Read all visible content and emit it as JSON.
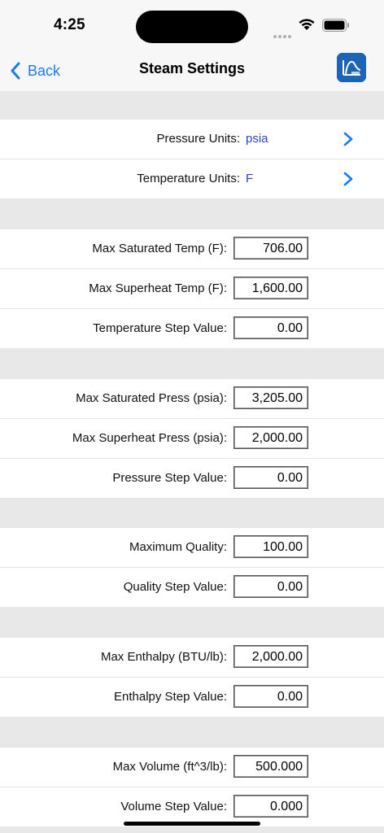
{
  "status": {
    "time": "4:25"
  },
  "nav": {
    "back_label": "Back",
    "title": "Steam Settings"
  },
  "units": [
    {
      "label": "Pressure Units:",
      "value": "psia"
    },
    {
      "label": "Temperature Units:",
      "value": "F"
    }
  ],
  "groups": [
    {
      "rows": [
        {
          "label": "Max Saturated Temp (F):",
          "value": "706.00"
        },
        {
          "label": "Max Superheat Temp (F):",
          "value": "1,600.00"
        },
        {
          "label": "Temperature Step Value:",
          "value": "0.00"
        }
      ]
    },
    {
      "rows": [
        {
          "label": "Max Saturated Press (psia):",
          "value": "3,205.00"
        },
        {
          "label": "Max Superheat Press (psia):",
          "value": "2,000.00"
        },
        {
          "label": "Pressure Step Value:",
          "value": "0.00"
        }
      ]
    },
    {
      "rows": [
        {
          "label": "Maximum Quality:",
          "value": "100.00"
        },
        {
          "label": "Quality Step Value:",
          "value": "0.00"
        }
      ]
    },
    {
      "rows": [
        {
          "label": "Max Enthalpy (BTU/lb):",
          "value": "2,000.00"
        },
        {
          "label": "Enthalpy Step Value:",
          "value": "0.00"
        }
      ]
    },
    {
      "rows": [
        {
          "label": "Max Volume (ft^3/lb):",
          "value": "500.000"
        },
        {
          "label": "Volume Step Value:",
          "value": "0.000"
        }
      ]
    }
  ],
  "colors": {
    "accent": "#1a7cf5",
    "unit_value": "#2f3fce",
    "group_bg": "#e8e8e8"
  }
}
